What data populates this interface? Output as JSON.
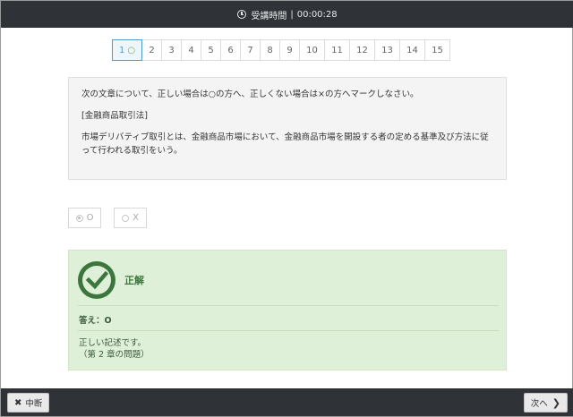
{
  "header": {
    "timer_label": "受講時間",
    "separator": "|",
    "timer_value": "00:00:28"
  },
  "pager": {
    "items": [
      "1",
      "2",
      "3",
      "4",
      "5",
      "6",
      "7",
      "8",
      "9",
      "10",
      "11",
      "12",
      "13",
      "14",
      "15"
    ],
    "active_index": 0,
    "active_mark": "○"
  },
  "question": {
    "instruction": "次の文章について、正しい場合は○の方へ、正しくない場合は×の方へマークしなさい。",
    "category": "[金融商品取引法]",
    "body": "市場デリバティブ取引とは、金融商品市場において、金融商品市場を開設する者の定める基準及び方法に従って行われる取引をいう。"
  },
  "choices": [
    {
      "label": "O",
      "selected": true
    },
    {
      "label": "X",
      "selected": false
    }
  ],
  "result": {
    "title": "正解",
    "answer": "答え：O",
    "explanation": "正しい記述です。",
    "chapter": "（第 2 章の問題）",
    "accent_color": "#3c763d",
    "background_color": "#dff0d8"
  },
  "footer": {
    "suspend_label": "中断",
    "next_label": "次へ"
  }
}
